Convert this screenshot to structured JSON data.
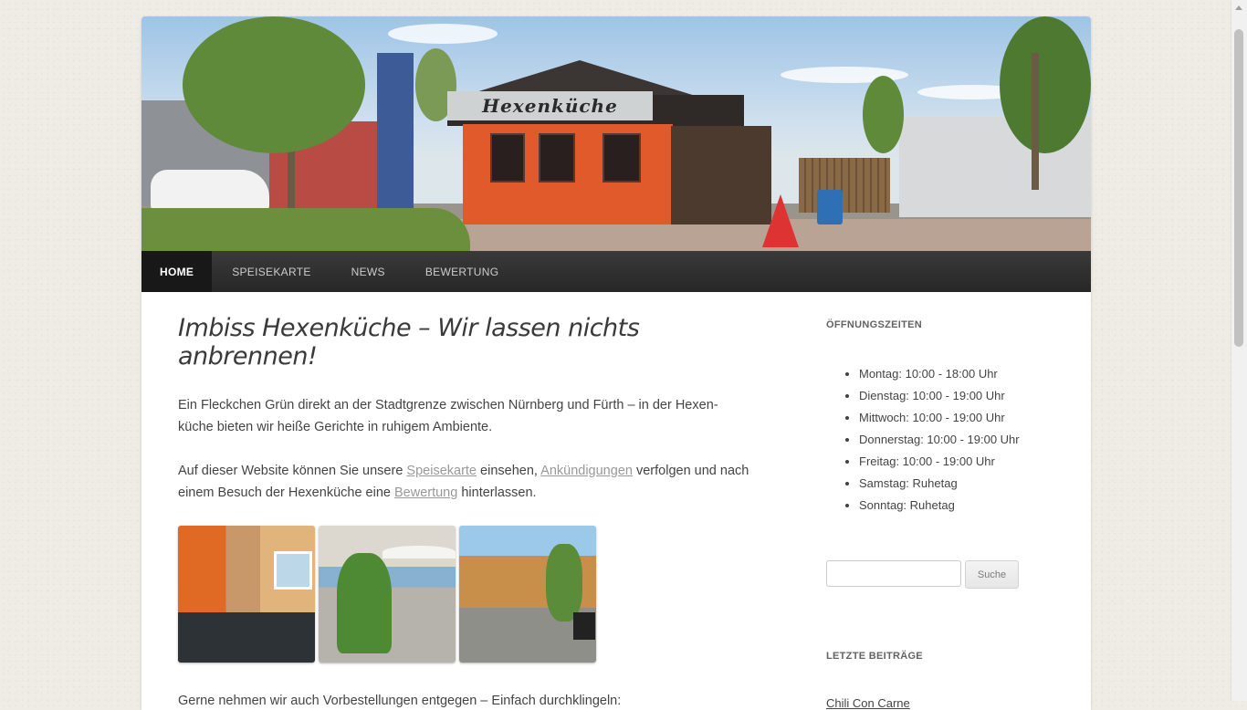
{
  "nav": {
    "items": [
      {
        "label": "Home",
        "active": true
      },
      {
        "label": "Speisekarte",
        "active": false
      },
      {
        "label": "News",
        "active": false
      },
      {
        "label": "Bewertung",
        "active": false
      }
    ]
  },
  "banner": {
    "sign_text": "Hexenküche"
  },
  "main": {
    "title": "Imbiss Hexenküche – Wir lassen nichts anbrennen!",
    "p1": "Ein Fleckchen Grün direkt an der Stadtgrenze zwischen Nürnberg und Fürth – in der Hexen-küche bieten wir heiße Gerichte in ruhigem Ambiente.",
    "p2_before": "Auf dieser Website können Sie unsere ",
    "p2_link1": "Speisekarte",
    "p2_mid1": " einsehen, ",
    "p2_link2": "Ankündigungen",
    "p2_mid2": " verfolgen und nach einem Besuch der Hexenküche eine ",
    "p2_link3": "Bewertung",
    "p2_after": " hinterlassen.",
    "p3": "Gerne nehmen wir auch Vorbestellungen entgegen – Einfach durchklingeln:"
  },
  "sidebar": {
    "hours_title": "Öffnungszeiten",
    "hours": [
      "Montag: 10:00 - 18:00 Uhr",
      "Dienstag: 10:00 - 19:00 Uhr",
      "Mittwoch: 10:00 - 19:00 Uhr",
      "Donnerstag: 10:00 - 19:00 Uhr",
      "Freitag: 10:00 - 19:00 Uhr",
      "Samstag: Ruhetag",
      "Sonntag: Ruhetag"
    ],
    "search_value": "",
    "search_button": "Suche",
    "recent_title": "Letzte Beiträge",
    "recent_posts": [
      "Chili Con Carne"
    ]
  },
  "colors": {
    "nav_bg": "#272727",
    "nav_active": "#181818",
    "link": "#999999",
    "shop_orange": "#e05a2c"
  }
}
